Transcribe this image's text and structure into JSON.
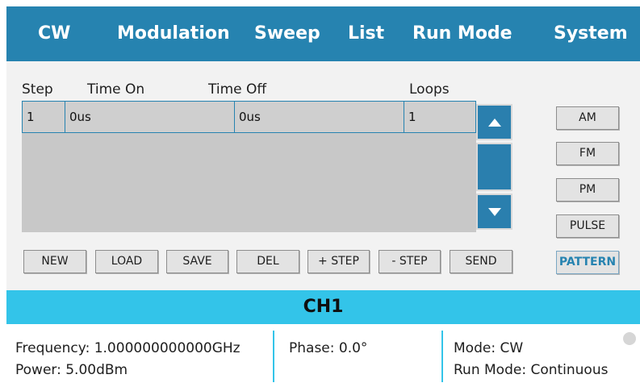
{
  "menu": {
    "items": [
      {
        "label": "CW"
      },
      {
        "label": "Modulation"
      },
      {
        "label": "Sweep"
      },
      {
        "label": "List"
      },
      {
        "label": "Run Mode"
      },
      {
        "label": "System"
      }
    ]
  },
  "table": {
    "columns": [
      "Step",
      "Time On",
      "Time Off",
      "Loops"
    ],
    "rows": [
      {
        "step": "1",
        "time_on": "0us",
        "time_off": "0us",
        "loops": "1"
      }
    ]
  },
  "actions": {
    "new": "NEW",
    "load": "LOAD",
    "save": "SAVE",
    "del": "DEL",
    "add_step": "+ STEP",
    "remove_step": "- STEP",
    "send": "SEND"
  },
  "modulation_types": {
    "am": "AM",
    "fm": "FM",
    "pm": "PM",
    "pulse": "PULSE",
    "pattern": "PATTERN"
  },
  "channel": {
    "name": "CH1"
  },
  "status": {
    "frequency": "Frequency: 1.000000000000GHz",
    "power": "Power: 5.00dBm",
    "phase": "Phase: 0.0°",
    "mode": "Mode: CW",
    "run_mode": "Run Mode: Continuous"
  },
  "colors": {
    "menubar": "#2683b0",
    "channel_bar": "#33c4e9",
    "accent": "#2683b0",
    "panel": "#f2f2f2"
  }
}
